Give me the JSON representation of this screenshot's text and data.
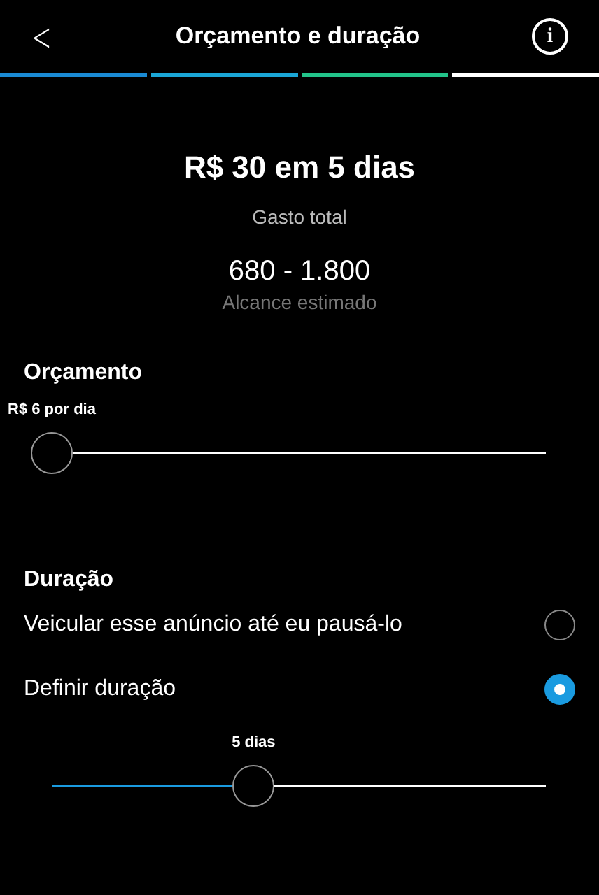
{
  "header": {
    "back": "<",
    "title": "Orçamento e duração",
    "info": "i"
  },
  "progress_steps": [
    {
      "color": "#1a8ad4"
    },
    {
      "color": "#1aa6d6"
    },
    {
      "color": "#22c48a"
    },
    {
      "color": "#ffffff"
    }
  ],
  "summary": {
    "amount": "R$ 30 em 5 dias",
    "amount_label": "Gasto total",
    "reach": "680 - 1.800",
    "reach_label": "Alcance estimado"
  },
  "budget": {
    "heading": "Orçamento",
    "slider_label": "R$ 6 por dia",
    "level": 0
  },
  "duration": {
    "heading": "Duração",
    "options": [
      {
        "label": "Veicular esse anúncio até eu pausá-lo",
        "selected": false
      },
      {
        "label": "Definir duração",
        "selected": true
      }
    ],
    "slider_label": "5 dias",
    "level": 0.4
  }
}
